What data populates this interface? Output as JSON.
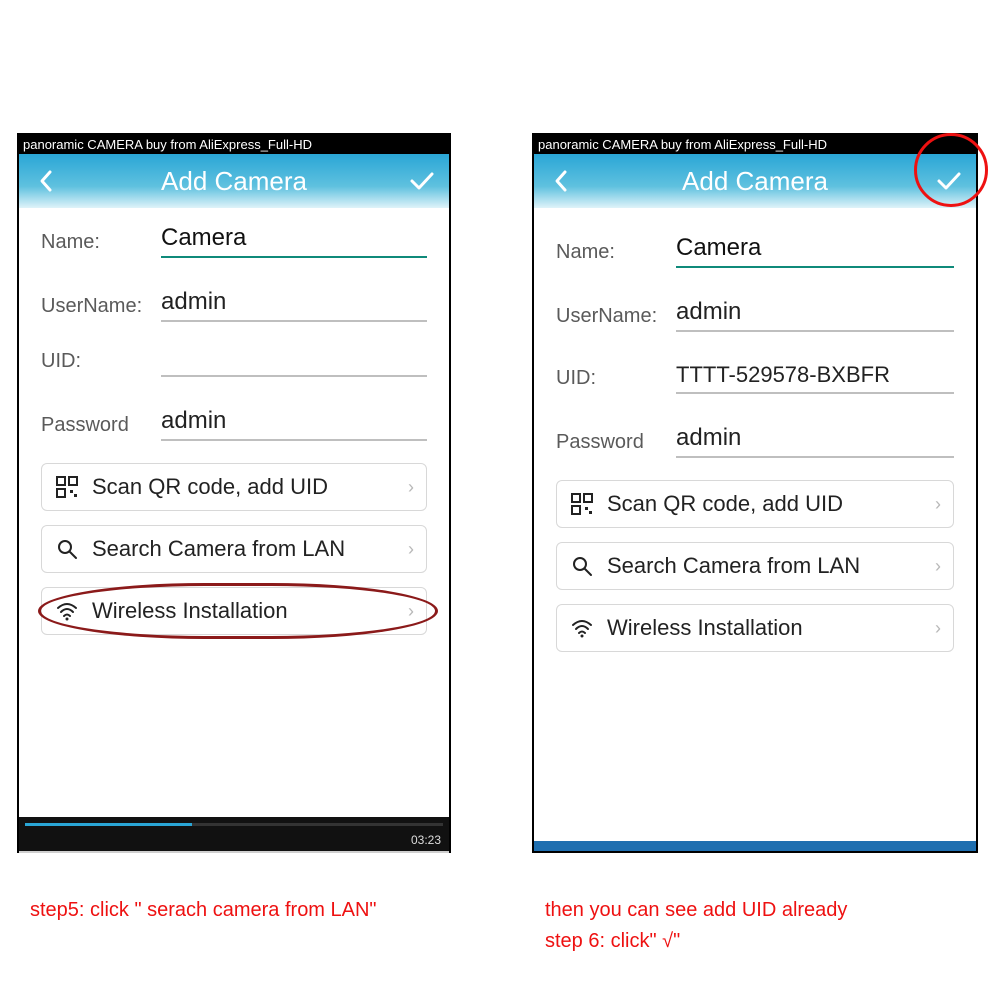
{
  "video_caption": "panoramic CAMERA buy from AliExpress_Full-HD",
  "app_title": "Add Camera",
  "fields": {
    "name_label": "Name:",
    "username_label": "UserName:",
    "uid_label": "UID:",
    "password_label": "Password"
  },
  "left": {
    "name_value": "Camera",
    "username_value": "admin",
    "uid_value": "",
    "password_value": "admin",
    "video_time": "03:23"
  },
  "right": {
    "name_value": "Camera",
    "username_value": "admin",
    "uid_value": "TTTT-529578-BXBFR",
    "password_value": "admin"
  },
  "options": {
    "scan_qr": "Scan QR code, add UID",
    "search_lan": "Search Camera from LAN",
    "wireless": "Wireless Installation"
  },
  "captions": {
    "step5": "step5: click \" serach camera from LAN\"",
    "right_a": "then you can see add UID already",
    "right_b": "step 6: click\" √\""
  }
}
